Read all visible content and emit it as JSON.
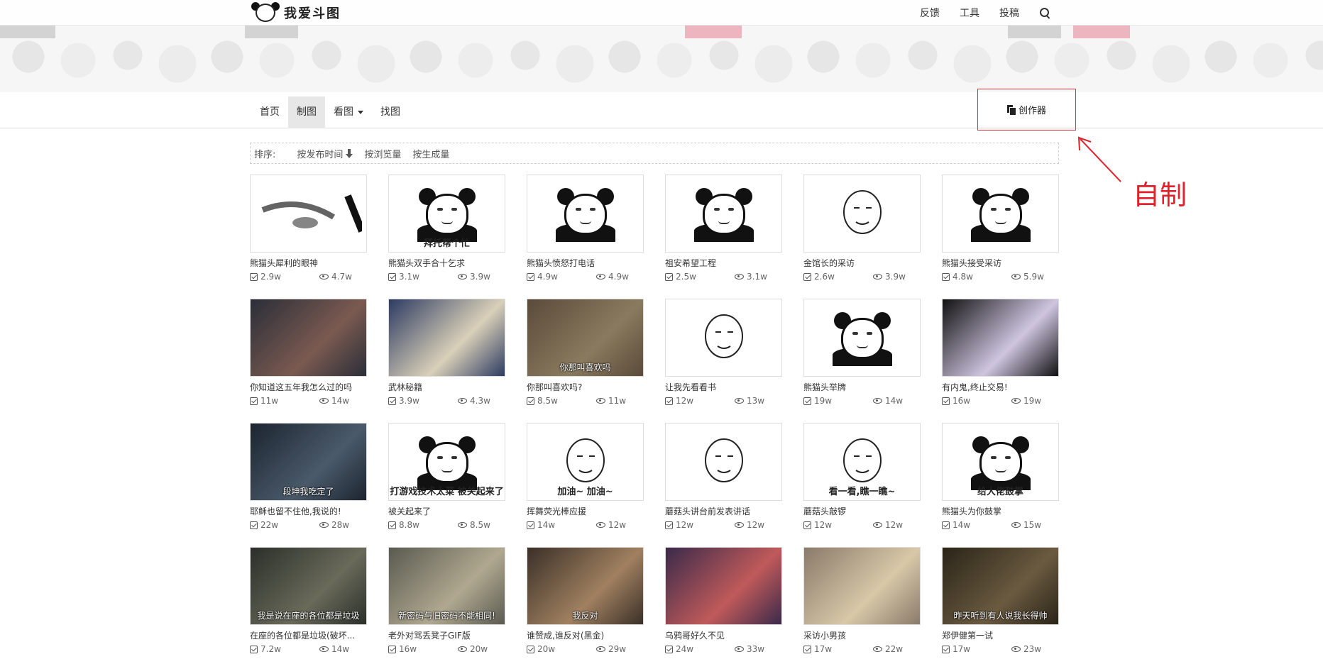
{
  "site": {
    "logo_text": "我爱斗图"
  },
  "topnav": {
    "feedback": "反馈",
    "tools": "工具",
    "submit": "投稿"
  },
  "subnav": {
    "items": [
      "首页",
      "制图",
      "看图",
      "找图"
    ],
    "creator": "创作器"
  },
  "annotation": {
    "text": "自制"
  },
  "sort": {
    "label": "排序:",
    "by_time": "按发布时间",
    "by_views": "按浏览量",
    "by_generated": "按生成量"
  },
  "items": [
    {
      "title": "熊猫头犀利的眼神",
      "made": "2.9w",
      "views": "4.7w",
      "caption": "",
      "kind": "blur"
    },
    {
      "title": "熊猫头双手合十乞求",
      "made": "3.1w",
      "views": "3.9w",
      "caption": "拜托帮个忙",
      "kind": "panda"
    },
    {
      "title": "熊猫头愤怒打电话",
      "made": "4.9w",
      "views": "4.9w",
      "caption": "",
      "kind": "panda"
    },
    {
      "title": "祖安希望工程",
      "made": "2.5w",
      "views": "3.1w",
      "caption": "",
      "kind": "panda"
    },
    {
      "title": "金馆长的采访",
      "made": "2.6w",
      "views": "3.9w",
      "caption": "",
      "kind": "sketch"
    },
    {
      "title": "熊猫头接受采访",
      "made": "4.8w",
      "views": "5.9w",
      "caption": "",
      "kind": "panda"
    },
    {
      "title": "你知道这五年我怎么过的吗",
      "made": "11w",
      "views": "14w",
      "caption": "",
      "kind": "photo",
      "c1": "#2a2e38",
      "c2": "#7a5a50"
    },
    {
      "title": "武林秘籍",
      "made": "3.9w",
      "views": "4.3w",
      "caption": "",
      "kind": "photo",
      "c1": "#2d3b63",
      "c2": "#d9d0b8"
    },
    {
      "title": "你那叫喜欢吗?",
      "made": "8.5w",
      "views": "11w",
      "caption": "你那叫喜欢吗",
      "kind": "photo",
      "c1": "#5a4a3a",
      "c2": "#8a7a5e"
    },
    {
      "title": "让我先看看书",
      "made": "12w",
      "views": "13w",
      "caption": "",
      "kind": "sketch"
    },
    {
      "title": "熊猫头举牌",
      "made": "19w",
      "views": "14w",
      "caption": "",
      "kind": "panda"
    },
    {
      "title": "有内鬼,终止交易!",
      "made": "16w",
      "views": "19w",
      "caption": "",
      "kind": "photo",
      "c1": "#111111",
      "c2": "#cfc5e0"
    },
    {
      "title": "耶稣也留不住他,我说的!",
      "made": "22w",
      "views": "28w",
      "caption": "段坤我吃定了",
      "kind": "photo",
      "c1": "#1c2430",
      "c2": "#4a5a6a"
    },
    {
      "title": "被关起来了",
      "made": "8.8w",
      "views": "8.5w",
      "caption": "打游戏技术太菜 被关起来了",
      "kind": "panda"
    },
    {
      "title": "挥舞荧光棒应援",
      "made": "14w",
      "views": "12w",
      "caption": "加油~ 加油~",
      "kind": "sketch"
    },
    {
      "title": "蘑菇头讲台前发表讲话",
      "made": "12w",
      "views": "12w",
      "caption": "",
      "kind": "sketch"
    },
    {
      "title": "蘑菇头敲锣",
      "made": "12w",
      "views": "12w",
      "caption": "看一看,瞧一瞧~",
      "kind": "sketch"
    },
    {
      "title": "熊猫头为你鼓掌",
      "made": "14w",
      "views": "15w",
      "caption": "给大佬鼓掌",
      "kind": "panda"
    },
    {
      "title": "在座的各位都是垃圾(破坏...",
      "made": "7.2w",
      "views": "14w",
      "caption": "我是说在座的各位都是垃圾",
      "kind": "photo",
      "c1": "#2a2f2a",
      "c2": "#6a6a5a"
    },
    {
      "title": "老外对骂丢凳子GIF版",
      "made": "16w",
      "views": "20w",
      "caption": "新密码与旧密码不能相同!",
      "kind": "photo",
      "c1": "#5a5a50",
      "c2": "#b0a890"
    },
    {
      "title": "谁赞成,谁反对(黑金)",
      "made": "20w",
      "views": "29w",
      "caption": "我反对",
      "kind": "photo",
      "c1": "#3a3028",
      "c2": "#a08060"
    },
    {
      "title": "乌鸦哥好久不见",
      "made": "24w",
      "views": "33w",
      "caption": "",
      "kind": "photo",
      "c1": "#3a2a4a",
      "c2": "#c05a5a"
    },
    {
      "title": "采访小男孩",
      "made": "17w",
      "views": "22w",
      "caption": "",
      "kind": "photo",
      "c1": "#8a7a6a",
      "c2": "#d8c8a8"
    },
    {
      "title": "郑伊健第一试",
      "made": "17w",
      "views": "23w",
      "caption": "昨天听到有人说我长得帅",
      "kind": "photo",
      "c1": "#2a2418",
      "c2": "#6a5a40"
    }
  ]
}
